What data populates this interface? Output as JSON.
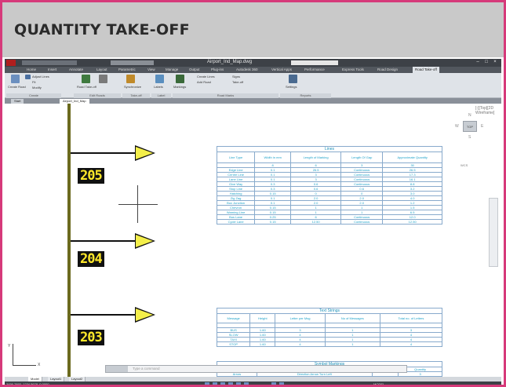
{
  "banner": {
    "title": "QUANTITY TAKE-OFF"
  },
  "app": {
    "window_title": "Airport_Ind_Map.dwg",
    "search_placeholder": "Type a keyword or phrase",
    "workspace": "Drafting & Annotation",
    "window_controls": [
      "–",
      "□",
      "×"
    ]
  },
  "ribbon": {
    "tabs": [
      "Home",
      "Insert",
      "Annotate",
      "Layout",
      "Parametric",
      "View",
      "Manage",
      "Output",
      "Plug-ins",
      "Autodesk 360",
      "Vertical Apps",
      "Performance",
      "Express Tools",
      "Road Design",
      "Road Take-off"
    ],
    "active_tab": "Road Take-off",
    "buttons": [
      "Create Road",
      "Adjust Lines",
      "Fit",
      "Modify",
      "Road Take-off",
      "Synchronize",
      "Labels",
      "Markings",
      "Create Lines",
      "Add Road",
      "Signs",
      "Take-off",
      "Settings"
    ],
    "panels": [
      "Create",
      "Edit Roads",
      "Take-off",
      "Label",
      "Road Marks",
      "Reports"
    ]
  },
  "file_tabs": [
    "Start",
    "Airport_Ind_Map"
  ],
  "stations": [
    {
      "label": "205"
    },
    {
      "label": "204"
    },
    {
      "label": "203"
    }
  ],
  "tables": {
    "lines": {
      "title": "Lines",
      "headers": [
        "Line Type",
        "Width in mm",
        "Length of Marking",
        "Length Of Gap",
        "Approximate Quantity"
      ],
      "rows": [
        [
          "",
          "8",
          "6",
          "3",
          "30"
        ],
        [
          "Edge Line",
          "0.1",
          "26.5",
          "Continuous",
          "26.5"
        ],
        [
          "Centre Line",
          "0.1",
          "3",
          "Continuous",
          "17.3"
        ],
        [
          "Lane Line",
          "0.1",
          "3",
          "Continuous",
          "16.1"
        ],
        [
          "Give Way",
          "0.3",
          "0.6",
          "Continuous",
          "8.8"
        ],
        [
          "Stop Line",
          "0.3",
          "0.6",
          "0.6",
          "3.2"
        ],
        [
          "Hatching",
          "0.15",
          "0",
          "0",
          "3.0"
        ],
        [
          "Zig Zag",
          "0.1",
          "2.0",
          "2.0",
          "4.0"
        ],
        [
          "Box Junction",
          "0.1",
          "2.0",
          "2.0",
          "1.2"
        ],
        [
          "Chevron",
          "0.15",
          "1",
          "1",
          "1.5"
        ],
        [
          "Warning Line",
          "0.15",
          "1",
          "1",
          "6.5"
        ],
        [
          "Bus Lane",
          "0.25",
          "6",
          "Continuous",
          "12.0"
        ],
        [
          "Cycle Lane",
          "0.15",
          "12.50",
          "Continuous",
          "12.50"
        ]
      ]
    },
    "text": {
      "title": "Text Strings",
      "headers": [
        "Message",
        "Height",
        "Letter per Msg",
        "No of Messages",
        "Total no. of Letters"
      ],
      "rows": [
        [
          "",
          "",
          "",
          "",
          ""
        ],
        [
          "BUS",
          "1.60",
          "3",
          "1",
          "3"
        ],
        [
          "SLOW",
          "1.60",
          "4",
          "1",
          "4"
        ],
        [
          "TAXI",
          "1.60",
          "4",
          "1",
          "4"
        ],
        [
          "STOP",
          "1.60",
          "4",
          "1",
          "4"
        ]
      ]
    },
    "symbols": {
      "title": "Symbol Markings",
      "headers": [
        "Symbol",
        "Description",
        "Size",
        "Quantity"
      ],
      "rows": [
        [
          "Arrow",
          "Direction Arrow Turn Left",
          "",
          "3"
        ]
      ]
    }
  },
  "viewcube": {
    "face": "TOP",
    "n": "N",
    "s": "S",
    "e": "E",
    "w": "W",
    "wcs": "WCS"
  },
  "viewport_label": "[-][Top][2D Wireframe]",
  "ucs": {
    "x": "X",
    "y": "Y"
  },
  "command_line": {
    "placeholder": "Type a command"
  },
  "layout_tabs": [
    "Model",
    "Layout1",
    "Layout2"
  ],
  "active_layout": "Model",
  "status": {
    "coords": "3456.7893, 1234.5678, 0.0000",
    "model_label": "MODEL"
  }
}
